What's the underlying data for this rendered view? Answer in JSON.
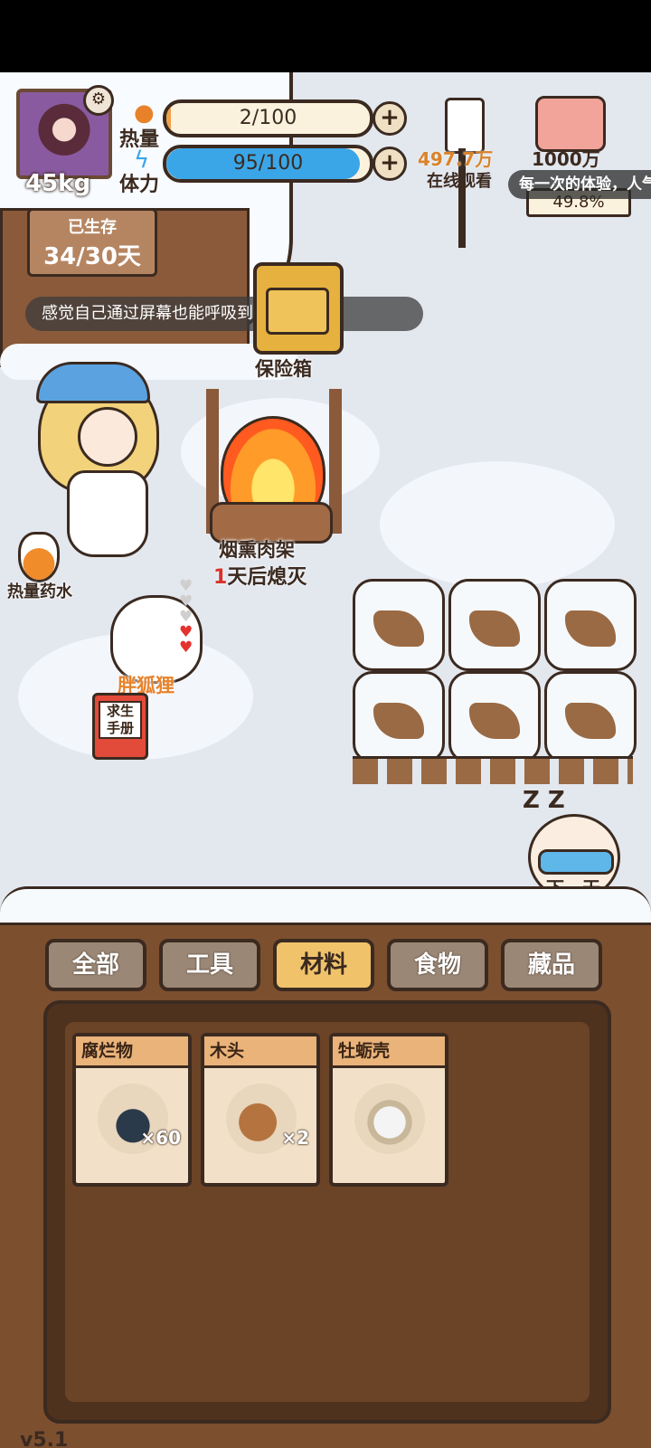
{
  "player": {
    "weight": "45kg",
    "calories_label": "热量",
    "stamina_label": "体力",
    "calories_text": "2/100",
    "calories_fraction": 0.02,
    "stamina_text": "95/100",
    "stamina_fraction": 0.95
  },
  "survival": {
    "label": "已生存",
    "days": "34/30天"
  },
  "stream": {
    "viewers": "497.7万",
    "viewers_label": "在线观看",
    "goal": "1000万",
    "popularity": "49.8%",
    "ticker": "每一次的体验，人气突破进度"
  },
  "dialogue": "感觉自己通过屏幕也能呼吸到这新鲜空气。",
  "objects": {
    "safe": "保险箱",
    "smoker": "烟熏肉架",
    "burn_num": "1",
    "burn_rest": "天后熄灭",
    "potion": "热量药水",
    "fox": "胖狐狸",
    "book": "求生手册",
    "zzz": "Z Z",
    "next_day": "下一天"
  },
  "fox_hearts": {
    "filled": 2,
    "total": 5
  },
  "tabs": [
    {
      "label": "全部",
      "active": false
    },
    {
      "label": "工具",
      "active": false
    },
    {
      "label": "材料",
      "active": true
    },
    {
      "label": "食物",
      "active": false
    },
    {
      "label": "藏品",
      "active": false
    }
  ],
  "items": [
    {
      "name": "腐烂物",
      "qty": "×60",
      "icon": "rotten-pile-icon"
    },
    {
      "name": "木头",
      "qty": "×2",
      "icon": "wood-log-icon"
    },
    {
      "name": "牡蛎壳",
      "qty": "",
      "icon": "oyster-shell-icon"
    }
  ],
  "version": "v5.1",
  "colors": {
    "stamina": "#3aa6e8",
    "active_tab": "#f0c36b",
    "inactive_tab": "#9b8775",
    "shelf": "#7c4f2f"
  }
}
